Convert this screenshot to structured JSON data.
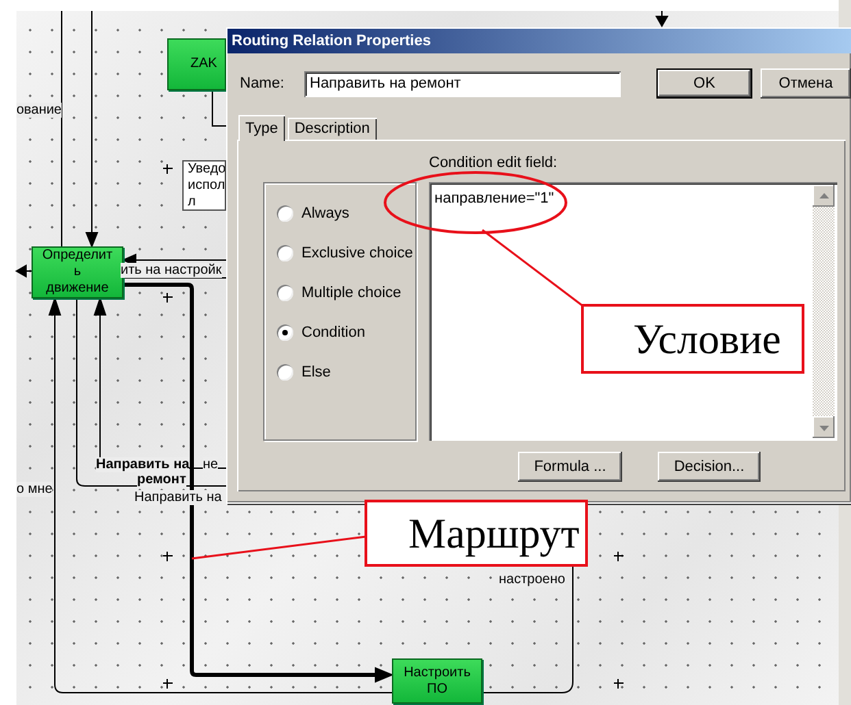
{
  "canvas": {
    "nodes": [
      {
        "kind": "activity",
        "lines": [
          "ZAK"
        ]
      },
      {
        "kind": "activity",
        "lines": [
          "Определит",
          "ь",
          "движение"
        ]
      },
      {
        "kind": "activity",
        "lines": [
          "Настроить",
          "ПО"
        ]
      },
      {
        "kind": "note",
        "lines": [
          "Уведо",
          "испол",
          "л"
        ]
      }
    ],
    "edge_labels": [
      {
        "text": "ование",
        "bold": false
      },
      {
        "text": "ить на настройк",
        "bold": false
      },
      {
        "text": "Направить на",
        "bold": true
      },
      {
        "text": "ремонт",
        "bold": true
      },
      {
        "text": "не",
        "bold": false
      },
      {
        "text": "Направить на",
        "bold": false
      },
      {
        "text": "о мне",
        "bold": false
      },
      {
        "text": "настроено",
        "bold": false
      }
    ]
  },
  "dialog": {
    "title": "Routing Relation Properties",
    "name_label": "Name:",
    "name_value": "Направить на ремонт",
    "buttons": [
      "OK",
      "Отмена"
    ],
    "tabs": [
      {
        "label": "Type",
        "selected": true
      },
      {
        "label": "Description",
        "selected": false
      }
    ],
    "condition_label": "Condition edit field:",
    "condition_value": "направление=\"1\"",
    "options": [
      {
        "label": "Always",
        "selected": false
      },
      {
        "label": "Exclusive choice",
        "selected": false
      },
      {
        "label": "Multiple choice",
        "selected": false
      },
      {
        "label": "Condition",
        "selected": true
      },
      {
        "label": "Else",
        "selected": false
      }
    ],
    "action_buttons": [
      "Formula ...",
      "Decision..."
    ]
  },
  "annotations": [
    {
      "text": "Условие"
    },
    {
      "text": "Маршрут"
    }
  ]
}
